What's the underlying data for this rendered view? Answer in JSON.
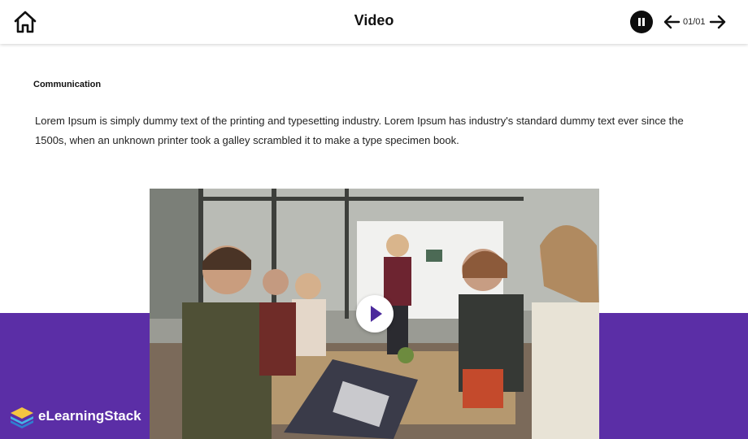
{
  "header": {
    "title": "Video",
    "page_counter": "01/01",
    "icons": {
      "home": "home-icon",
      "pause": "pause-icon",
      "previous": "arrow-left-icon",
      "next": "arrow-right-icon"
    }
  },
  "content": {
    "heading": "Communication",
    "paragraph": "Lorem Ipsum is simply dummy text of the printing and typesetting industry. Lorem Ipsum has industry's standard dummy text ever since the 1500s, when an unknown printer took a galley scrambled it to make a type specimen book."
  },
  "video": {
    "state": "paused",
    "play_icon": "play-icon"
  },
  "brand": {
    "name": "eLearningStack"
  },
  "colors": {
    "accent_purple": "#5b2ea6",
    "play_triangle": "#4b2a9c",
    "header_bg": "#ffffff",
    "text": "#111111"
  }
}
